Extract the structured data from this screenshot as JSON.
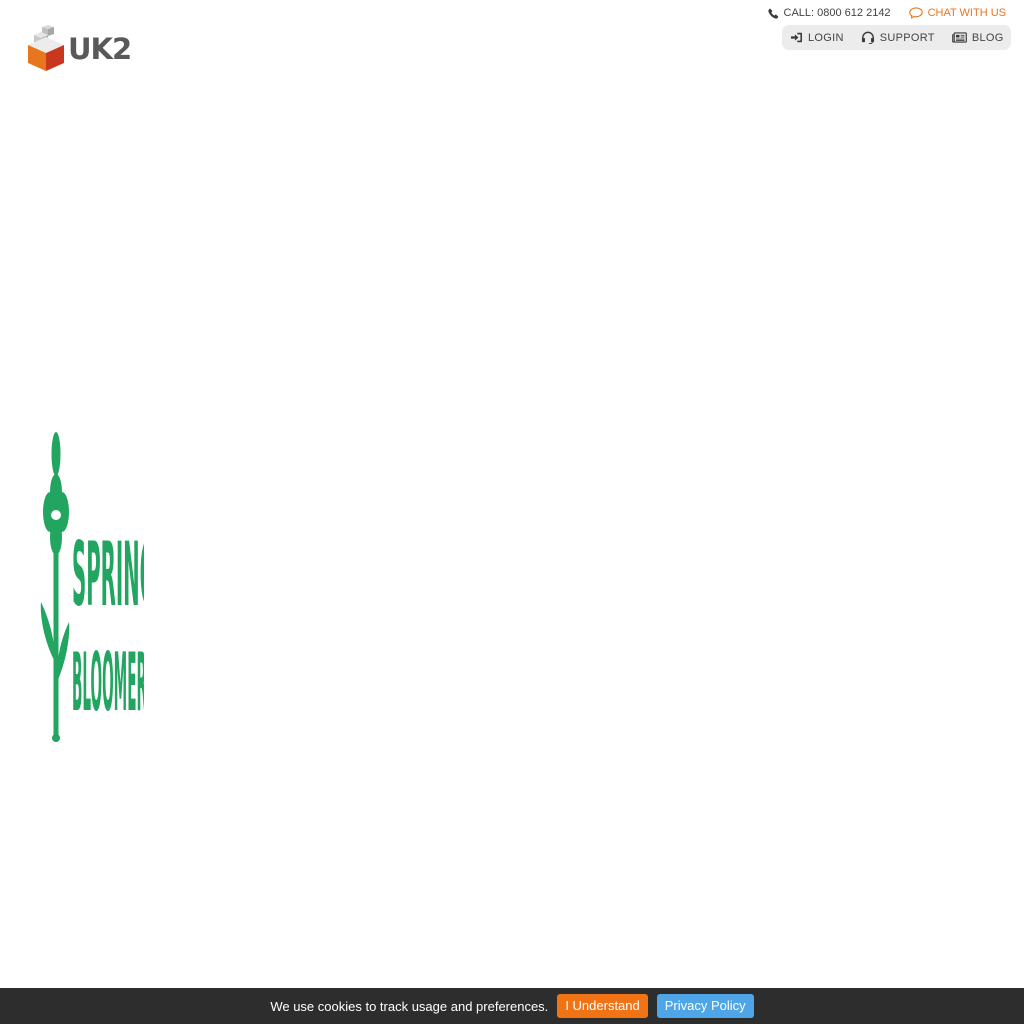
{
  "brand": {
    "name": "UK2",
    "colors": {
      "orange": "#e8761e",
      "red": "#c9381e",
      "grey": "#595959",
      "green": "#22a560"
    }
  },
  "top_bar": {
    "call": {
      "icon": "phone-icon",
      "label": "CALL: 0800 612 2142"
    },
    "chat": {
      "icon": "chat-bubble-icon",
      "label": "CHAT WITH US"
    }
  },
  "nav": {
    "items": [
      {
        "icon": "login-icon",
        "label": "LOGIN"
      },
      {
        "icon": "headset-icon",
        "label": "SUPPORT"
      },
      {
        "icon": "newspaper-icon",
        "label": "BLOG"
      }
    ]
  },
  "promo": {
    "line1": "SPRING",
    "line2": "BLOOMERS"
  },
  "cookie_bar": {
    "message": "We use cookies to track usage and preferences.",
    "accept_label": "I Understand",
    "policy_label": "Privacy Policy"
  }
}
